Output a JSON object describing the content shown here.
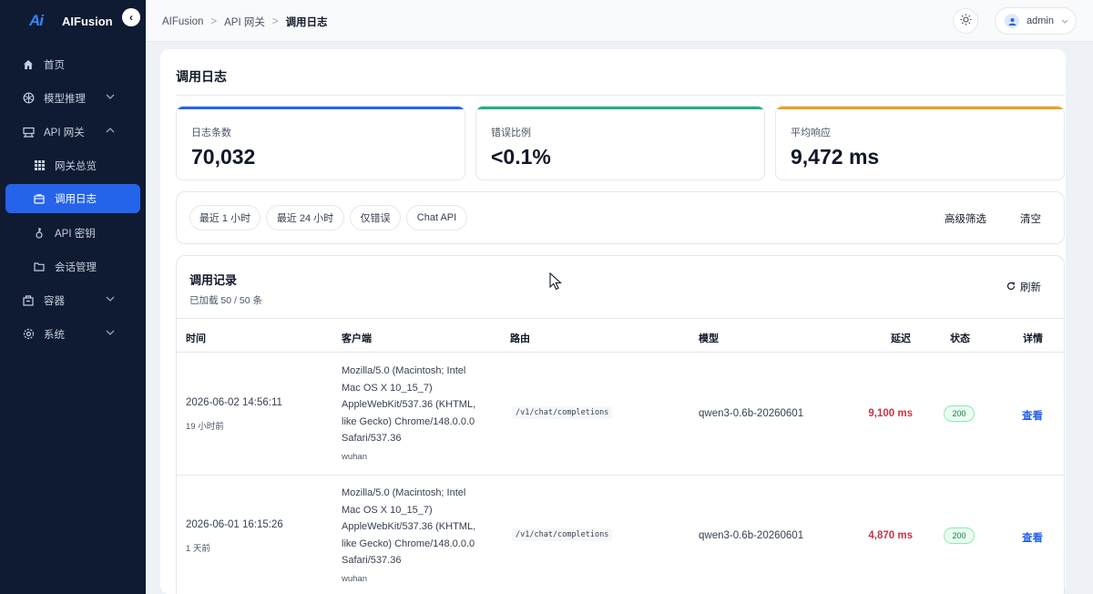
{
  "app": {
    "name": "AIFusion",
    "logo_text": "Ai"
  },
  "sidebar": {
    "items": [
      {
        "label": "首页",
        "icon": "home-icon"
      },
      {
        "label": "模型推理",
        "icon": "model-icon",
        "expandable": true
      },
      {
        "label": "API 网关",
        "icon": "gateway-icon",
        "expanded": true
      },
      {
        "label": "网关总览",
        "icon": "grid-icon",
        "sub": true
      },
      {
        "label": "调用日志",
        "icon": "log-icon",
        "sub": true,
        "active": true
      },
      {
        "label": "API 密钥",
        "icon": "key-icon",
        "sub": true
      },
      {
        "label": "会话管理",
        "icon": "folder-icon",
        "sub": true
      },
      {
        "label": "容器",
        "icon": "container-icon",
        "expandable": true
      },
      {
        "label": "系统",
        "icon": "settings-icon",
        "expandable": true
      }
    ]
  },
  "breadcrumb": [
    "AIFusion",
    "API 网关",
    "调用日志"
  ],
  "user": {
    "name": "admin"
  },
  "page": {
    "title": "调用日志"
  },
  "stats": [
    {
      "label": "日志条数",
      "value": "70,032",
      "color": "#2563eb"
    },
    {
      "label": "错误比例",
      "value": "<0.1%",
      "color": "#22b07d"
    },
    {
      "label": "平均响应",
      "value": "9,472 ms",
      "color": "#f0a020"
    }
  ],
  "filters": {
    "chips": [
      "最近 1 小时",
      "最近 24 小时",
      "仅错误",
      "Chat API"
    ],
    "advanced": "高级筛选",
    "clear": "清空"
  },
  "records": {
    "title": "调用记录",
    "subtitle": "已加载 50 / 50 条",
    "refresh": "刷新",
    "columns": [
      "时间",
      "客户端",
      "路由",
      "模型",
      "延迟",
      "状态",
      "详情"
    ],
    "rows": [
      {
        "time": "2026-06-02 14:56:11",
        "ago": "19 小时前",
        "ua_lines": [
          "Mozilla/5.0 (Macintosh; Intel",
          "Mac OS X 10_15_7)",
          "AppleWebKit/537.36 (KHTML,",
          "like Gecko) Chrome/148.0.0.0",
          "Safari/537.36"
        ],
        "location": "wuhan",
        "route": "/v1/chat/completions",
        "model": "qwen3-0.6b-20260601",
        "latency": "9,100 ms",
        "status": "200",
        "action": "查看"
      },
      {
        "time": "2026-06-01 16:15:26",
        "ago": "1 天前",
        "ua_lines": [
          "Mozilla/5.0 (Macintosh; Intel",
          "Mac OS X 10_15_7)",
          "AppleWebKit/537.36 (KHTML,",
          "like Gecko) Chrome/148.0.0.0",
          "Safari/537.36"
        ],
        "location": "wuhan",
        "route": "/v1/chat/completions",
        "model": "qwen3-0.6b-20260601",
        "latency": "4,870 ms",
        "status": "200",
        "action": "查看"
      }
    ]
  }
}
